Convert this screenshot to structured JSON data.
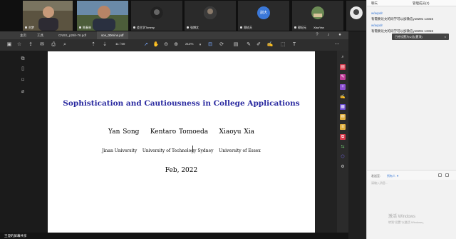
{
  "meeting": {
    "participants": [
      {
        "name": "刘梦",
        "type": "video"
      },
      {
        "name": "陈春林",
        "type": "video"
      },
      {
        "name": "会主学Tommy",
        "type": "avatar"
      },
      {
        "name": "张博文",
        "type": "avatar"
      },
      {
        "name": "郑玖天",
        "type": "initials",
        "initials": "訓大"
      },
      {
        "name": "郭纪元",
        "type": "avatar"
      },
      {
        "name": "XiaoYan",
        "type": "avatar"
      }
    ],
    "bottom_label": "王澄的屏幕共享"
  },
  "browser": {
    "tabs": [
      {
        "label": "主页"
      },
      {
        "label": "工具"
      },
      {
        "label": "CNSS_p26h-76.pdf"
      },
      {
        "label": "sce_00mins.pdf"
      }
    ],
    "page_indicator": "11 / 50",
    "zoom": "212%"
  },
  "paper": {
    "title": "Sophistication and Cautiousness in College Applications",
    "authors": "Yan Song    Kentaro Tomoeda    Xiaoyu Xia",
    "affiliations": "Jinan University    University of Technology Sydney    University of Essex",
    "date": "Feb, 2022"
  },
  "chat": {
    "header_tabs": [
      "聊天",
      "管理成员(2)"
    ],
    "messages": [
      {
        "sender": "w/aqodr",
        "text": "有需要论文的同学可以加微信y18291 13315"
      },
      {
        "sender": "w/aqodr",
        "text": "有需要论文的同学可以加微信y18291 13315"
      }
    ],
    "tooltip": "已经设置为公告(置顶)",
    "tooltip_close": "×",
    "send_to_label": "发送至:",
    "send_to_target": "所有人 ▼",
    "compose_placeholder": "请输入消息...",
    "watermark_title": "激活 Windows",
    "watermark_sub": "转到\"设置\"以激活 Windows。"
  },
  "colors": {
    "title_blue": "#2a2aa0",
    "chat_sender": "#3476d6"
  }
}
